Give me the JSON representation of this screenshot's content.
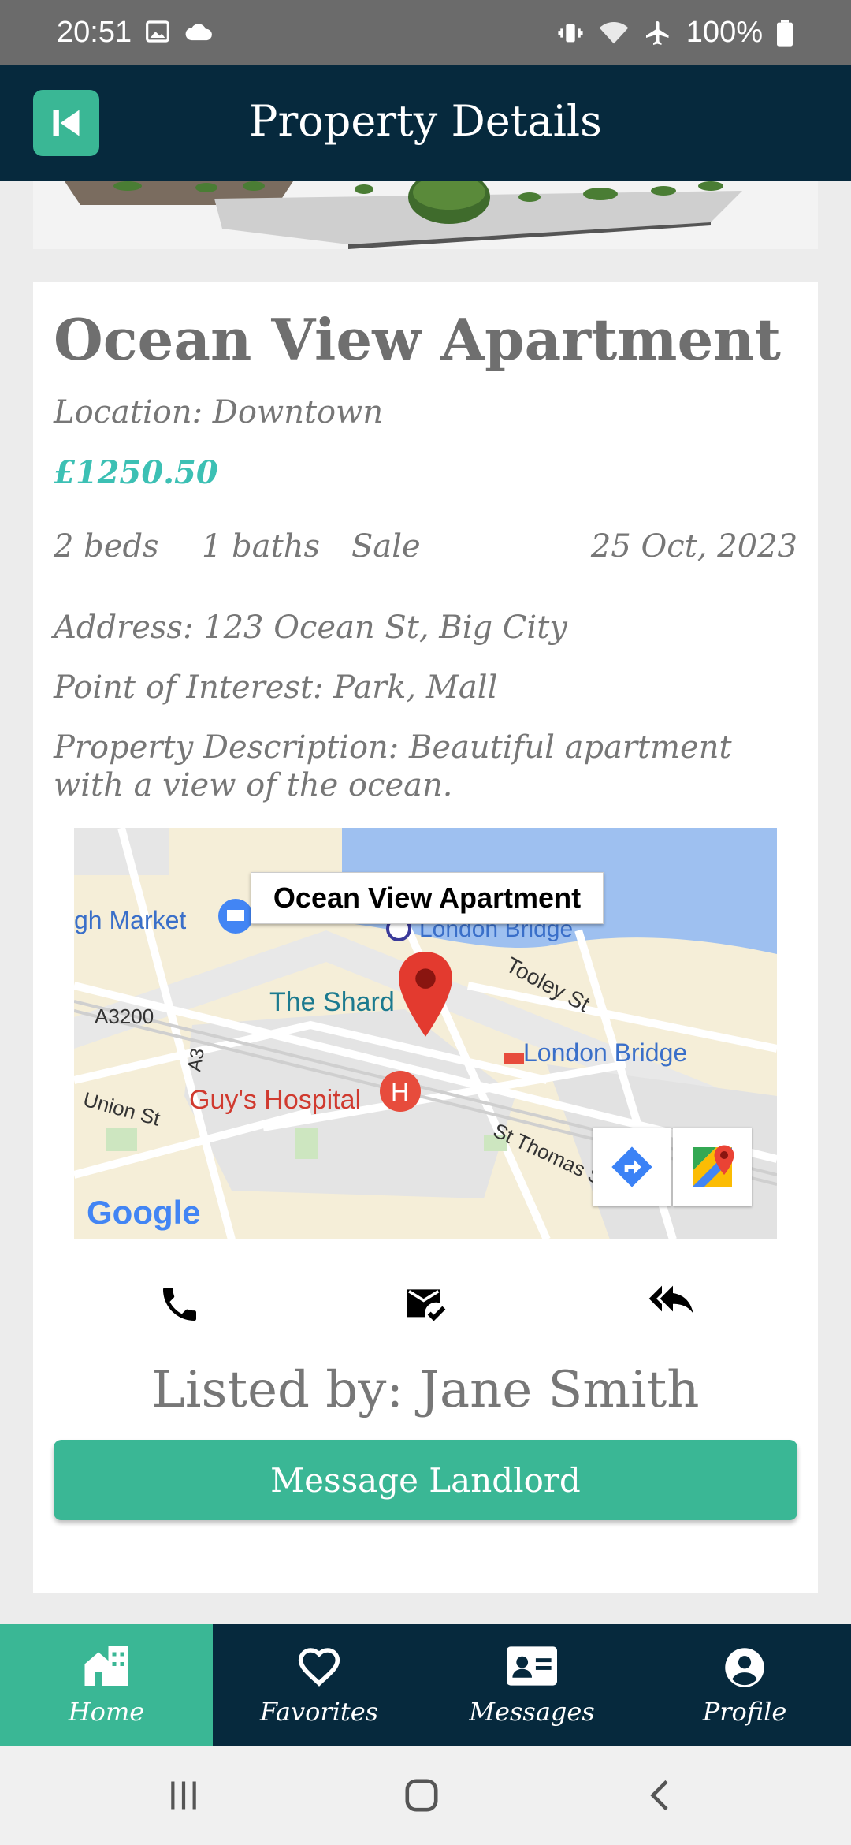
{
  "status_bar": {
    "time": "20:51",
    "battery": "100%"
  },
  "app_bar": {
    "title": "Property Details"
  },
  "property": {
    "title": "Ocean View Apartment",
    "location": "Location: Downtown",
    "price": "£1250.50",
    "beds": "2 beds",
    "baths": "1 baths",
    "type": "Sale",
    "date": "25 Oct, 2023",
    "address": "Address: 123 Ocean St, Big City",
    "poi": "Point of Interest: Park, Mall",
    "description": "Property Description: Beautiful apartment with a view of the ocean."
  },
  "map": {
    "marker_label": "Ocean View Apartment",
    "labels": {
      "market": "gh Market",
      "london_bridge_top": "London Bridge",
      "tooley": "Tooley St",
      "a3200": "A3200",
      "shard": "The Shard",
      "london_bridge_station": "London Bridge",
      "a3": "A3",
      "union": "Union St",
      "hospital": "Guy's Hospital",
      "st_thomas": "St Thomas St",
      "google": "Google"
    }
  },
  "contact": {
    "listed_by": "Listed by: Jane Smith",
    "message_button": "Message Landlord"
  },
  "bottom_nav": [
    {
      "label": "Home",
      "icon": "home-icon",
      "active": true
    },
    {
      "label": "Favorites",
      "icon": "heart-icon",
      "active": false
    },
    {
      "label": "Messages",
      "icon": "contact-card-icon",
      "active": false
    },
    {
      "label": "Profile",
      "icon": "account-circle-icon",
      "active": false
    }
  ],
  "colors": {
    "primary": "#06293d",
    "accent": "#3ab795",
    "price": "#3cc0b4"
  }
}
